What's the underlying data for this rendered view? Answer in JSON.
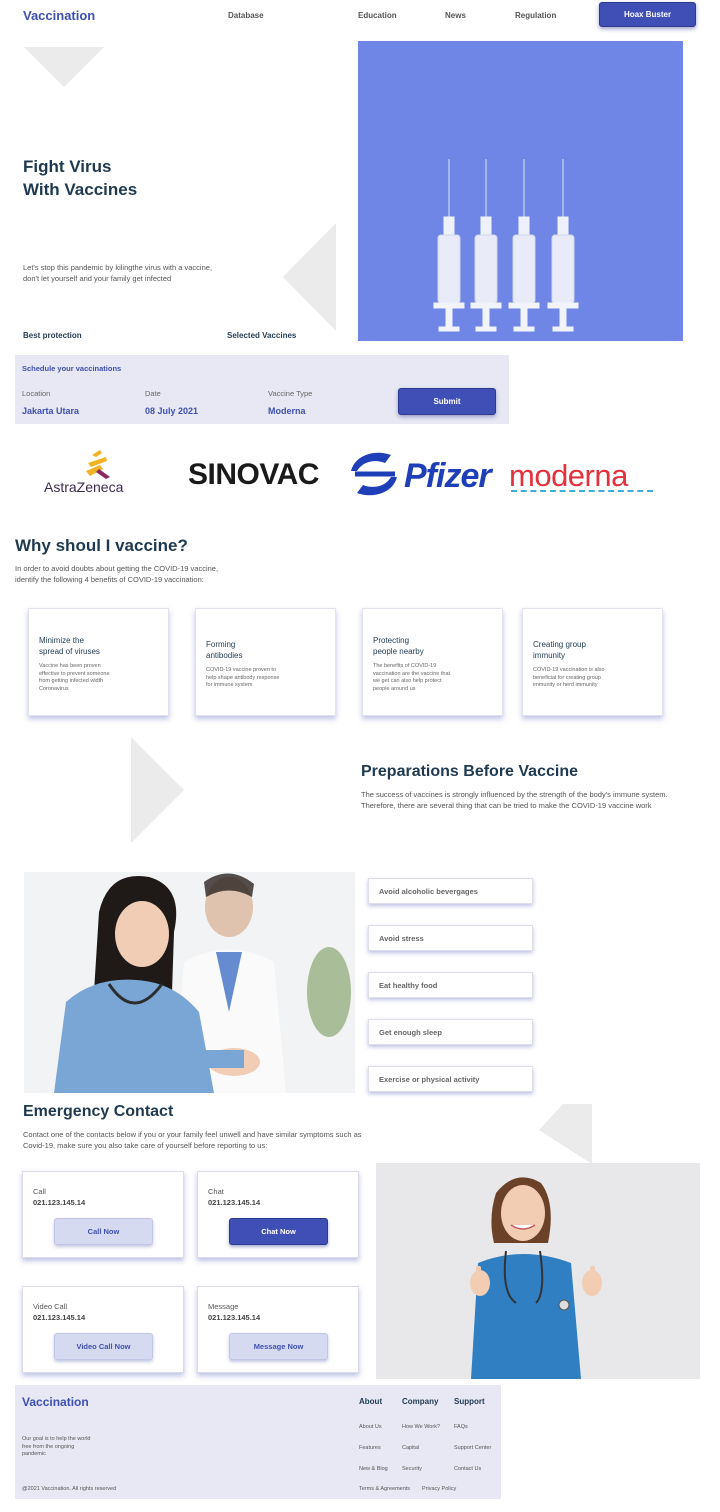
{
  "nav": {
    "brand": "Vaccination",
    "links": [
      "Database",
      "Education",
      "News",
      "Regulation"
    ],
    "cta": "Hoax Buster"
  },
  "hero": {
    "title_line1": "Fight Virus",
    "title_line2": "With Vaccines",
    "description": "Let's stop this pandemic by kilingthe virus with a vaccine, don't let yourself and your family get infected",
    "label_left": "Best protection",
    "label_right": "Selected Vaccines"
  },
  "schedule": {
    "title": "Schedule your vaccinations",
    "fields": [
      {
        "label": "Location",
        "value": "Jakarta Utara"
      },
      {
        "label": "Date",
        "value": "08 July 2021"
      },
      {
        "label": "Vaccine Type",
        "value": "Moderna"
      }
    ],
    "submit": "Submit"
  },
  "logos": {
    "astrazeneca": "AstraZeneca",
    "sinovac": "SINOVAC",
    "pfizer": "Pfizer",
    "moderna": "moderna"
  },
  "why": {
    "title": "Why shoul I vaccine?",
    "description": "In order to avoid doubts about getting the COVID-19 vaccine, identify the following 4 benefits of COVID-19 vaccination:",
    "benefits": [
      {
        "title_line1": "Minimize the",
        "title_line2": "spread of viruses",
        "desc": "Vaccine has been proven effective to prevent someone from getting infected width Coronavirus"
      },
      {
        "title_line1": "Forming",
        "title_line2": "antibodies",
        "desc": "COVID-19 vaccine proven to help shape antibody response for immune system"
      },
      {
        "title_line1": "Protecting",
        "title_line2": "people nearby",
        "desc": "The benefits of COVID-19 vaccination are the vaccine that we get can also help protect people around us"
      },
      {
        "title_line1": "Creating group",
        "title_line2": "immunity",
        "desc": "COVID-19 vaccination is also beneficial for creating group immunity or herd immunity"
      }
    ]
  },
  "preparations": {
    "title": "Preparations Before Vaccine",
    "description": "The success of vaccines is strongly influenced by the strength of the body's immune system. Therefore, there are several thing that can be tried to make the COVID-19 vaccine work",
    "items": [
      "Avoid alcoholic bevergages",
      "Avoid stress",
      "Eat healthy food",
      "Get enough sleep",
      "Exercise or physical activity"
    ]
  },
  "emergency": {
    "title": "Emergency Contact",
    "description": "Contact one of the contacts below if you or your family feel unwell and have similar symptoms such as Covid-19, make sure you also take care of yourself before reporting to us:",
    "contacts": [
      {
        "label": "Call",
        "number": "021.123.145.14",
        "button": "Call Now"
      },
      {
        "label": "Chat",
        "number": "021.123.145.14",
        "button": "Chat Now"
      },
      {
        "label": "Video Call",
        "number": "021.123.145.14",
        "button": "Video Call Now"
      },
      {
        "label": "Message",
        "number": "021.123.145.14",
        "button": "Message Now"
      }
    ]
  },
  "footer": {
    "brand": "Vaccination",
    "tagline": "Our goal is to help the world free from the ongoing pandemic",
    "copyright": "@2021 Vaccination. All rights reserved",
    "columns": [
      {
        "title": "About",
        "links": [
          "About Us",
          "Features",
          "New & Blog",
          "Terms & Agreements"
        ]
      },
      {
        "title": "Company",
        "links": [
          "How We Work?",
          "Capital",
          "Security",
          "Privacy Policy"
        ]
      },
      {
        "title": "Support",
        "links": [
          "FAQs",
          "Support Center",
          "Contact Us"
        ]
      }
    ]
  },
  "colors": {
    "brand": "#3f4fb0",
    "button": "#3f4fb5",
    "panel": "#e7e8f4",
    "heading": "#1f3a50",
    "hero_image_bg": "#6f86e6"
  }
}
